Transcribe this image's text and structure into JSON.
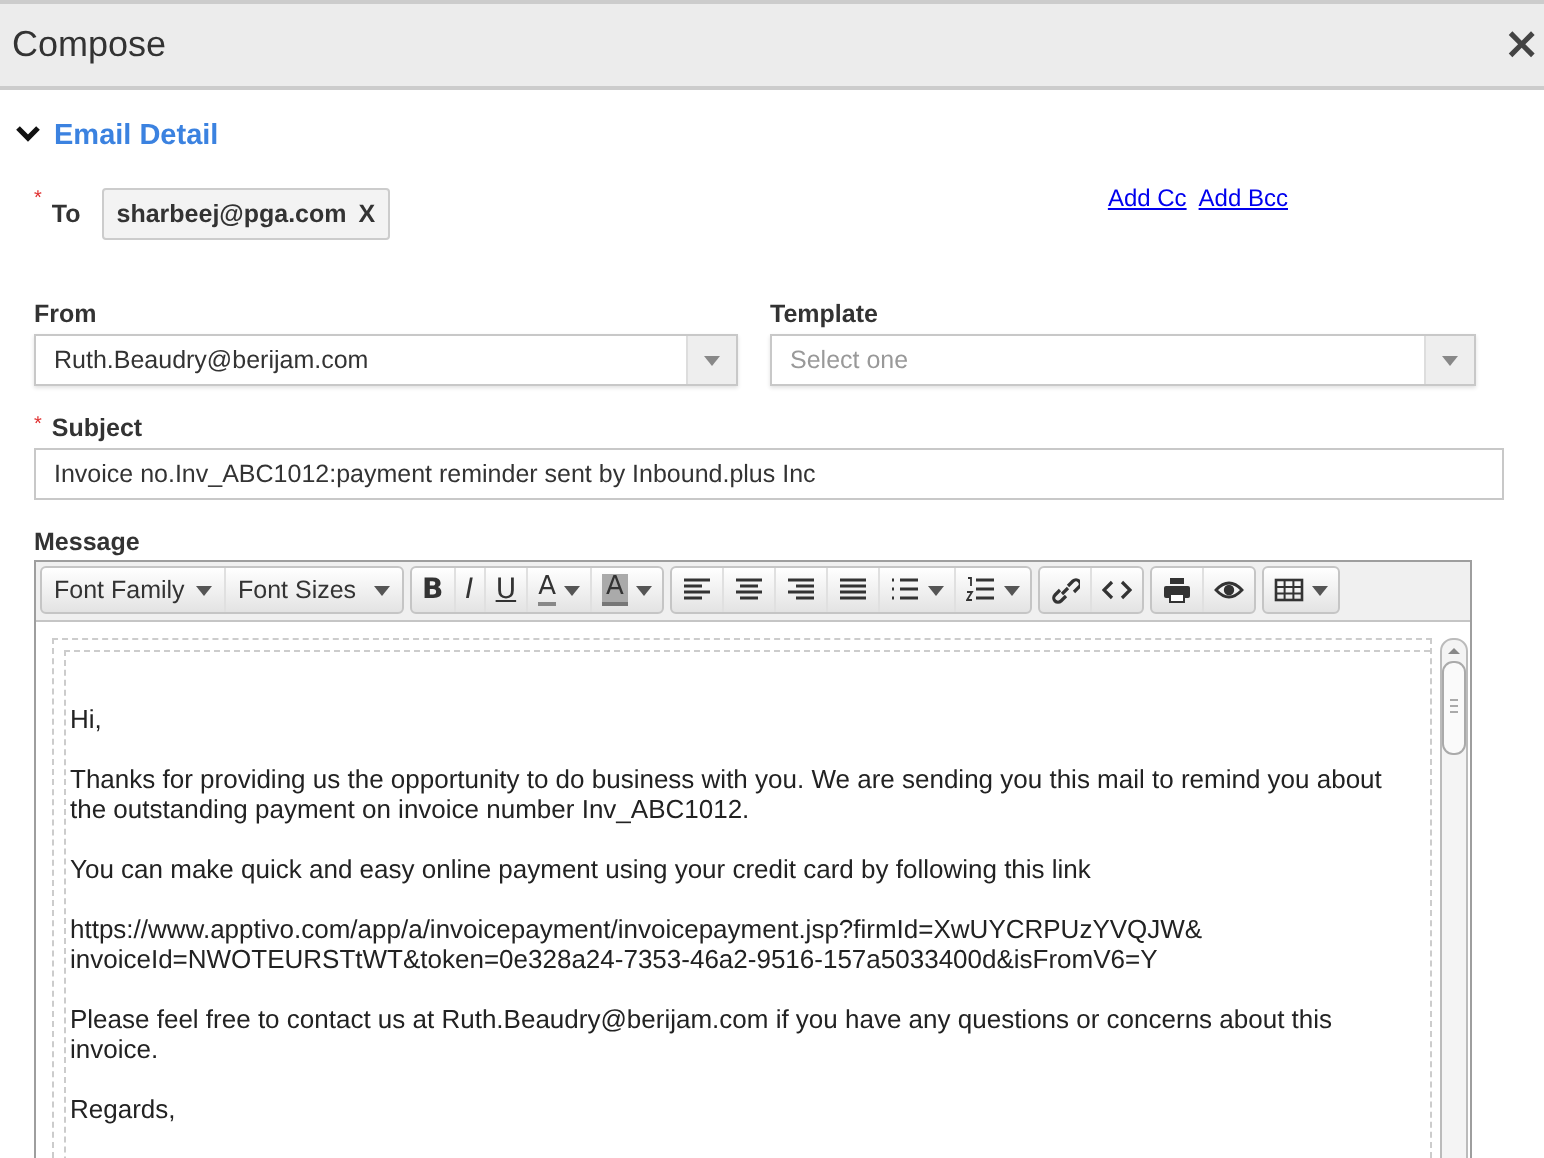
{
  "dialog": {
    "title": "Compose",
    "close": "×"
  },
  "section": {
    "title": "Email Detail",
    "expanded": true
  },
  "to": {
    "marker": "*",
    "label": "To",
    "recipients": [
      {
        "address": "sharbeej@pga.com",
        "remove": "X"
      }
    ]
  },
  "links": [
    "Add Cc",
    "Add Bcc"
  ],
  "from": {
    "label": "From",
    "value": "Ruth.Beaudry@berijam.com"
  },
  "template": {
    "label": "Template",
    "placeholder": "Select one"
  },
  "subject": {
    "marker": "*",
    "label": "Subject",
    "value": "Invoice no.Inv_ABC1012:payment reminder sent by Inbound.plus Inc"
  },
  "message": {
    "label": "Message",
    "toolbar": [
      [
        {
          "kind": "select",
          "label": "Font Family"
        },
        {
          "kind": "select",
          "label": "Font Sizes"
        }
      ],
      [
        {
          "kind": "bold",
          "label": "B"
        },
        {
          "kind": "italic",
          "label": "I"
        },
        {
          "kind": "underline",
          "label": "U"
        },
        {
          "kind": "forecolor",
          "label": "A",
          "caret": true
        },
        {
          "kind": "backcolor",
          "label": "A",
          "caret": true
        }
      ],
      [
        {
          "kind": "align-left"
        },
        {
          "kind": "align-center"
        },
        {
          "kind": "align-right"
        },
        {
          "kind": "justify"
        },
        {
          "kind": "bullets",
          "caret": true
        },
        {
          "kind": "numbers",
          "caret": true
        }
      ],
      [
        {
          "kind": "link"
        },
        {
          "kind": "code"
        }
      ],
      [
        {
          "kind": "print"
        },
        {
          "kind": "preview"
        }
      ],
      [
        {
          "kind": "table",
          "caret": true
        }
      ]
    ],
    "paragraphs": [
      [
        "Hi,"
      ],
      [
        "Thanks for providing us the opportunity to do business with you. We are sending you this mail to remind you about",
        "the outstanding payment on invoice number Inv_ABC1012."
      ],
      [
        "You can make quick and easy online payment using your credit card by following this link"
      ],
      [
        "https://www.apptivo.com/app/a/invoicepayment/invoicepayment.jsp?firmId=XwUYCRPUzYVQJW&",
        "invoiceId=NWOTEURSTtWT&token=0e328a24-7353-46a2-9516-157a5033400d&isFromV6=Y"
      ],
      [
        "Please feel free to contact us at Ruth.Beaudry@berijam.com if you have any questions or concerns about this",
        "invoice."
      ],
      [
        "Regards,"
      ]
    ]
  }
}
